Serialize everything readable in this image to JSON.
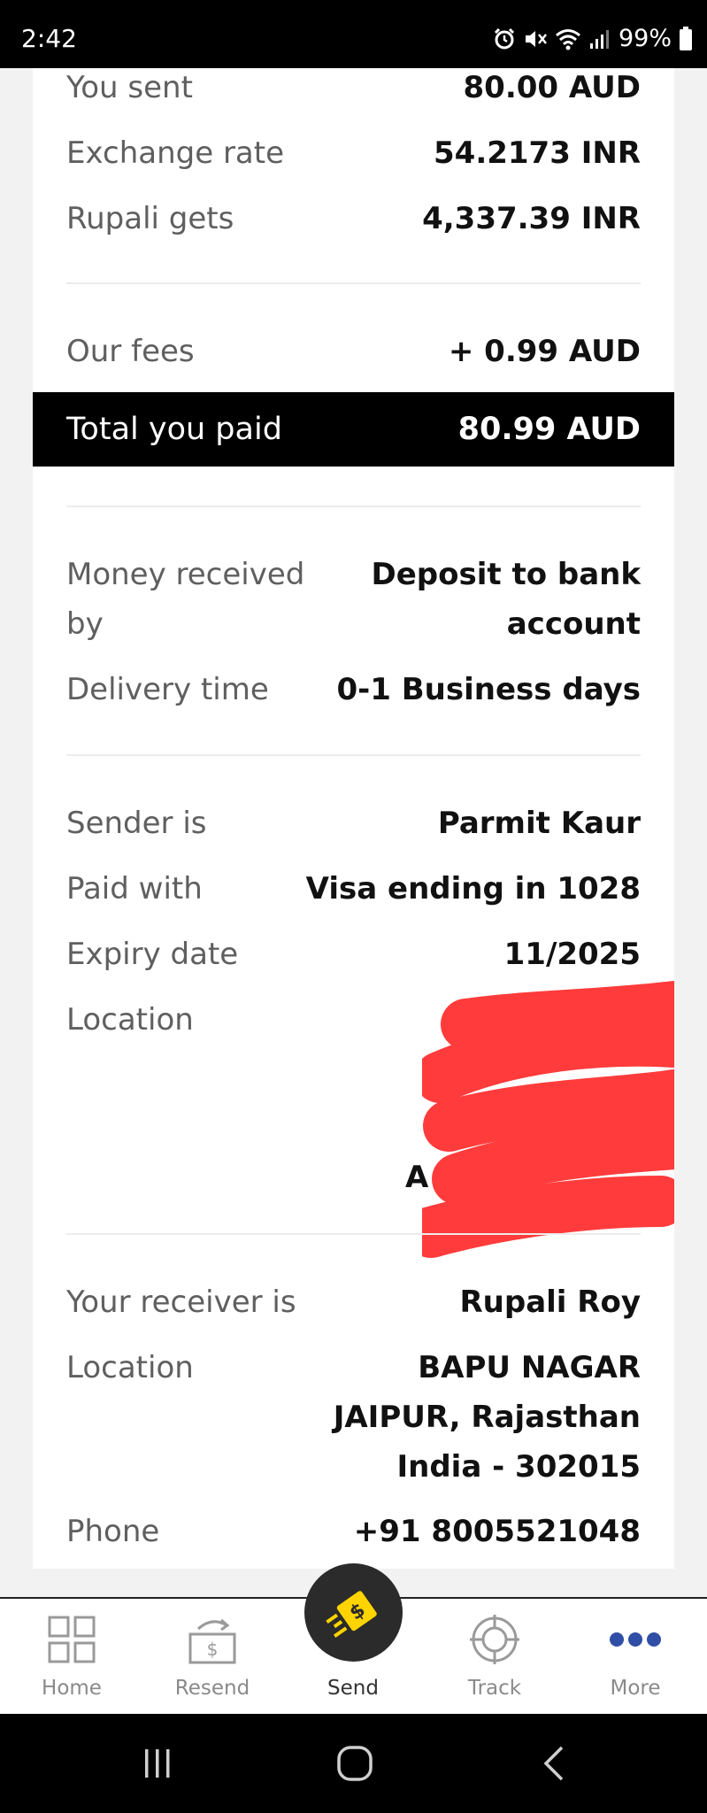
{
  "status_bar": {
    "time": "2:42",
    "battery": "99%",
    "icons": [
      "alarm-icon",
      "mute-icon",
      "wifi-icon",
      "signal-icon",
      "battery-icon"
    ]
  },
  "summary": {
    "you_sent": {
      "label": "You sent",
      "value": "80.00 AUD"
    },
    "exchange_rate": {
      "label": "Exchange rate",
      "value": "54.2173 INR"
    },
    "receiver_gets": {
      "label": "Rupali gets",
      "value": "4,337.39 INR"
    },
    "fees": {
      "label": "Our fees",
      "value": "+ 0.99 AUD"
    },
    "total": {
      "label": "Total you paid",
      "value": "80.99 AUD"
    }
  },
  "delivery": {
    "method": {
      "label_line1": "Money received",
      "label_line2": "by",
      "value_line1": "Deposit to bank",
      "value_line2": "account"
    },
    "time": {
      "label": "Delivery time",
      "value": "0-1 Business days"
    }
  },
  "sender": {
    "name": {
      "label": "Sender is",
      "value": "Parmit Kaur"
    },
    "paid_with": {
      "label": "Paid with",
      "value": "Visa ending in 1028"
    },
    "expiry": {
      "label": "Expiry date",
      "value": "11/2025"
    },
    "location": {
      "label": "Location",
      "visible_fragment": "A"
    }
  },
  "receiver": {
    "name": {
      "label": "Your receiver is",
      "value": "Rupali Roy"
    },
    "location": {
      "label": "Location",
      "line1": "BAPU NAGAR",
      "line2": "JAIPUR, Rajasthan",
      "line3": "India - 302015"
    },
    "phone": {
      "label": "Phone",
      "value": "+91 8005521048"
    }
  },
  "bottom_nav": {
    "items": [
      {
        "label": "Home",
        "icon": "home-grid-icon"
      },
      {
        "label": "Resend",
        "icon": "resend-icon"
      },
      {
        "label": "Send",
        "icon": "send-money-icon"
      },
      {
        "label": "Track",
        "icon": "track-target-icon"
      },
      {
        "label": "More",
        "icon": "more-dots-icon"
      }
    ]
  },
  "colors": {
    "accent_yellow": "#ffd400",
    "more_blue": "#2f4ea5",
    "redaction_red": "#ff3b3b",
    "total_bar": "#000000"
  }
}
